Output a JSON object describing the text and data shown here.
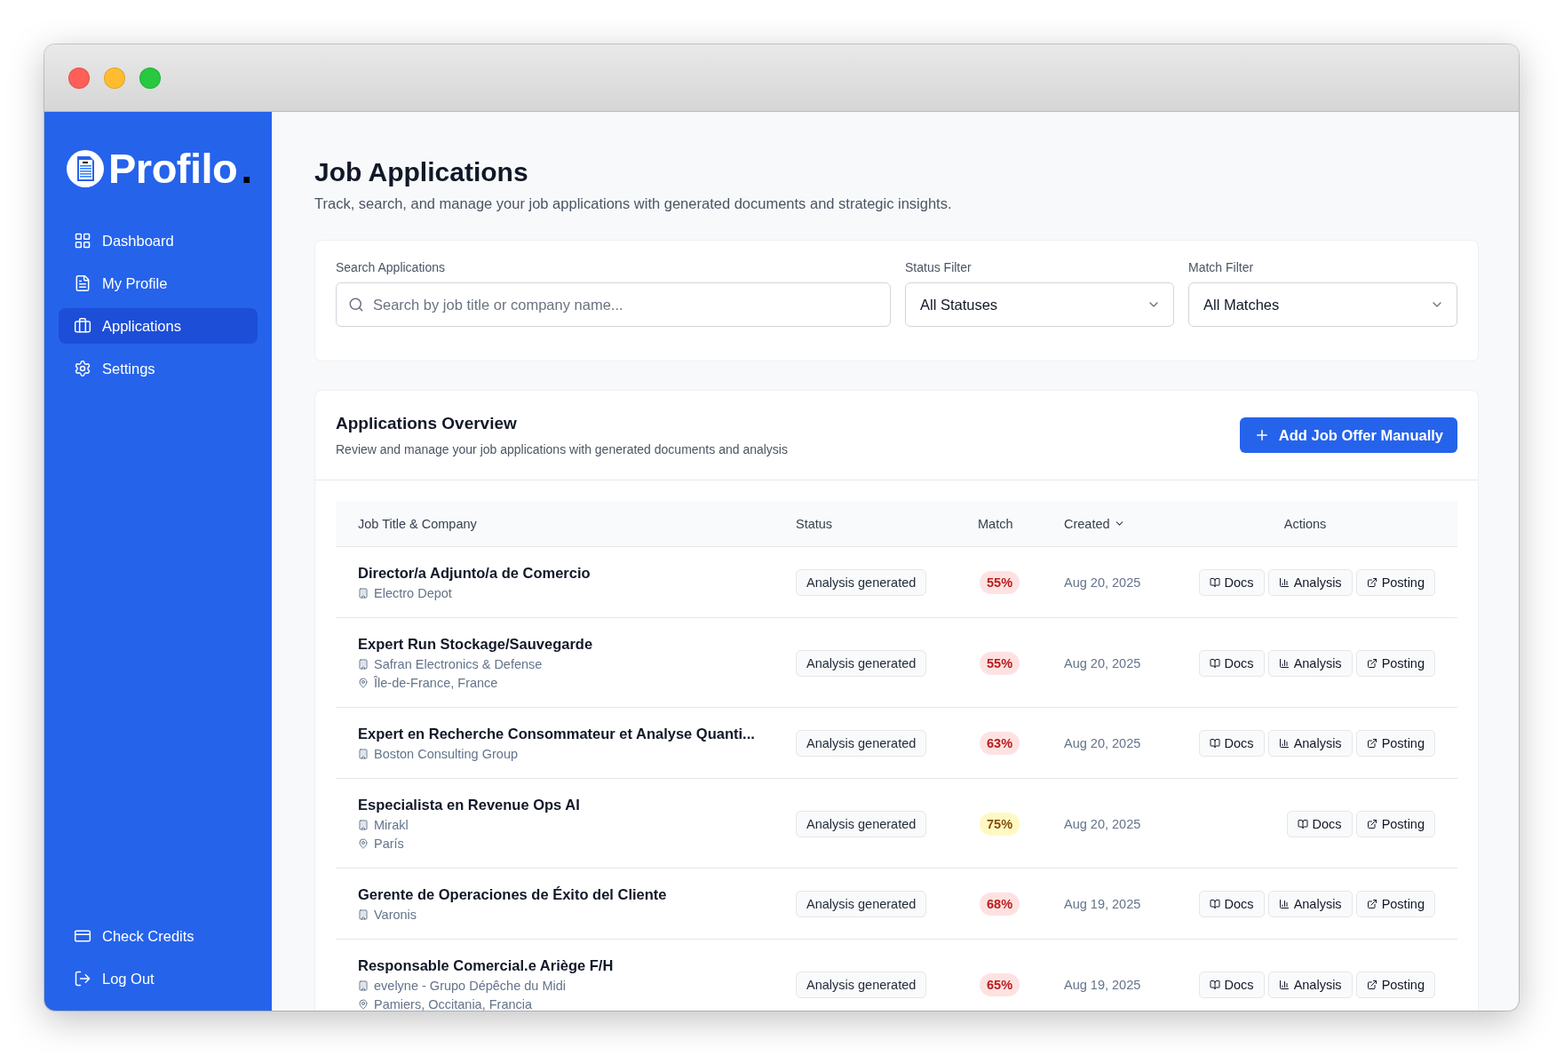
{
  "logo": {
    "name": "Profilo",
    "mark": "."
  },
  "sidebar": {
    "items": [
      {
        "kind": "dashboard",
        "label": "Dashboard",
        "selected": false
      },
      {
        "kind": "profile",
        "label": "My Profile",
        "selected": false
      },
      {
        "kind": "applications",
        "label": "Applications",
        "selected": true
      },
      {
        "kind": "settings",
        "label": "Settings",
        "selected": false
      }
    ],
    "footer_items": [
      {
        "kind": "credits",
        "label": "Check Credits"
      },
      {
        "kind": "logout",
        "label": "Log Out"
      }
    ]
  },
  "page": {
    "title": "Job Applications",
    "subtitle": "Track, search, and manage your job applications with generated documents and strategic insights."
  },
  "filters": {
    "search": {
      "label": "Search Applications",
      "placeholder": "Search by job title or company name..."
    },
    "status": {
      "label": "Status Filter",
      "value": "All Statuses"
    },
    "match": {
      "label": "Match Filter",
      "value": "All Matches"
    }
  },
  "overview": {
    "title": "Applications Overview",
    "subtitle": "Review and manage your job applications with generated documents and analysis",
    "add_button": "Add Job Offer Manually"
  },
  "table": {
    "columns": [
      "Job Title & Company",
      "Status",
      "Match",
      "Created",
      "Actions"
    ],
    "rows": [
      {
        "title": "Director/a Adjunto/a de Comercio",
        "company": "Electro Depot",
        "status": "Analysis generated",
        "match": "55%",
        "color": "#b91c1c",
        "created": "Aug 20, 2025",
        "actions": [
          {
            "kind": "docs",
            "label": "Docs"
          },
          {
            "kind": "analysis",
            "label": "Analysis"
          },
          {
            "kind": "posting",
            "label": "Posting"
          }
        ]
      },
      {
        "title": "Expert Run Stockage/Sauvegarde",
        "company": "Safran Electronics & Defense",
        "location": "Île-de-France, France",
        "status": "Analysis generated",
        "match": "55%",
        "color": "#b91c1c",
        "created": "Aug 20, 2025",
        "actions": [
          {
            "kind": "docs",
            "label": "Docs"
          },
          {
            "kind": "analysis",
            "label": "Analysis"
          },
          {
            "kind": "posting",
            "label": "Posting"
          }
        ]
      },
      {
        "title": "Expert en Recherche Consommateur et Analyse Quanti...",
        "company": "Boston Consulting Group",
        "status": "Analysis generated",
        "match": "63%",
        "color": "#b91c1c",
        "created": "Aug 20, 2025",
        "actions": [
          {
            "kind": "docs",
            "label": "Docs"
          },
          {
            "kind": "analysis",
            "label": "Analysis"
          },
          {
            "kind": "posting",
            "label": "Posting"
          }
        ]
      },
      {
        "title": "Especialista en Revenue Ops AI",
        "company": "Mirakl",
        "location": "París",
        "status": "Analysis generated",
        "match": "75%",
        "color": "#854d0e",
        "created": "Aug 20, 2025",
        "actions": [
          {
            "kind": "docs",
            "label": "Docs"
          },
          {
            "kind": "posting",
            "label": "Posting"
          }
        ]
      },
      {
        "title": "Gerente de Operaciones de Éxito del Cliente",
        "company": "Varonis",
        "status": "Analysis generated",
        "match": "68%",
        "color": "#b91c1c",
        "created": "Aug 19, 2025",
        "actions": [
          {
            "kind": "docs",
            "label": "Docs"
          },
          {
            "kind": "analysis",
            "label": "Analysis"
          },
          {
            "kind": "posting",
            "label": "Posting"
          }
        ]
      },
      {
        "title": "Responsable Comercial.e Ariège F/H",
        "company": "evelyne - Grupo Dépêche du Midi",
        "location": "Pamiers, Occitania, Francia",
        "status": "Analysis generated",
        "match": "65%",
        "color": "#b91c1c",
        "created": "Aug 19, 2025",
        "actions": [
          {
            "kind": "docs",
            "label": "Docs"
          },
          {
            "kind": "analysis",
            "label": "Analysis"
          },
          {
            "kind": "posting",
            "label": "Posting"
          }
        ]
      }
    ]
  }
}
